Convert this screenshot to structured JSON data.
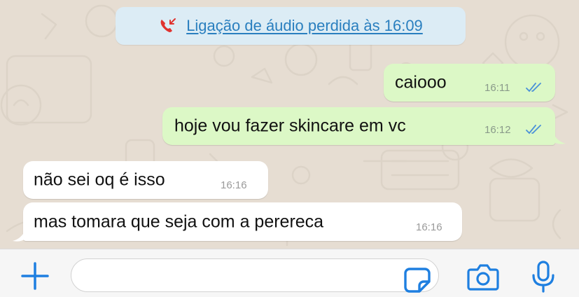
{
  "system_message": {
    "text": "Ligação de áudio perdida às 16:09",
    "icon": "missed-call-icon",
    "color": "#2a7fbf",
    "icon_color": "#e0332f"
  },
  "messages": [
    {
      "direction": "out",
      "text": "caiooo",
      "time": "16:11",
      "status": "read"
    },
    {
      "direction": "out",
      "text": "hoje vou fazer skincare em vc",
      "time": "16:12",
      "status": "read"
    },
    {
      "direction": "in",
      "text": "não sei oq é isso",
      "time": "16:16"
    },
    {
      "direction": "in",
      "text": "mas tomara que seja com a perereca",
      "time": "16:16"
    }
  ],
  "input_bar": {
    "plus_icon": "plus-icon",
    "sticker_icon": "sticker-icon",
    "camera_icon": "camera-icon",
    "mic_icon": "microphone-icon",
    "accent": "#1e7fe0",
    "placeholder": ""
  }
}
